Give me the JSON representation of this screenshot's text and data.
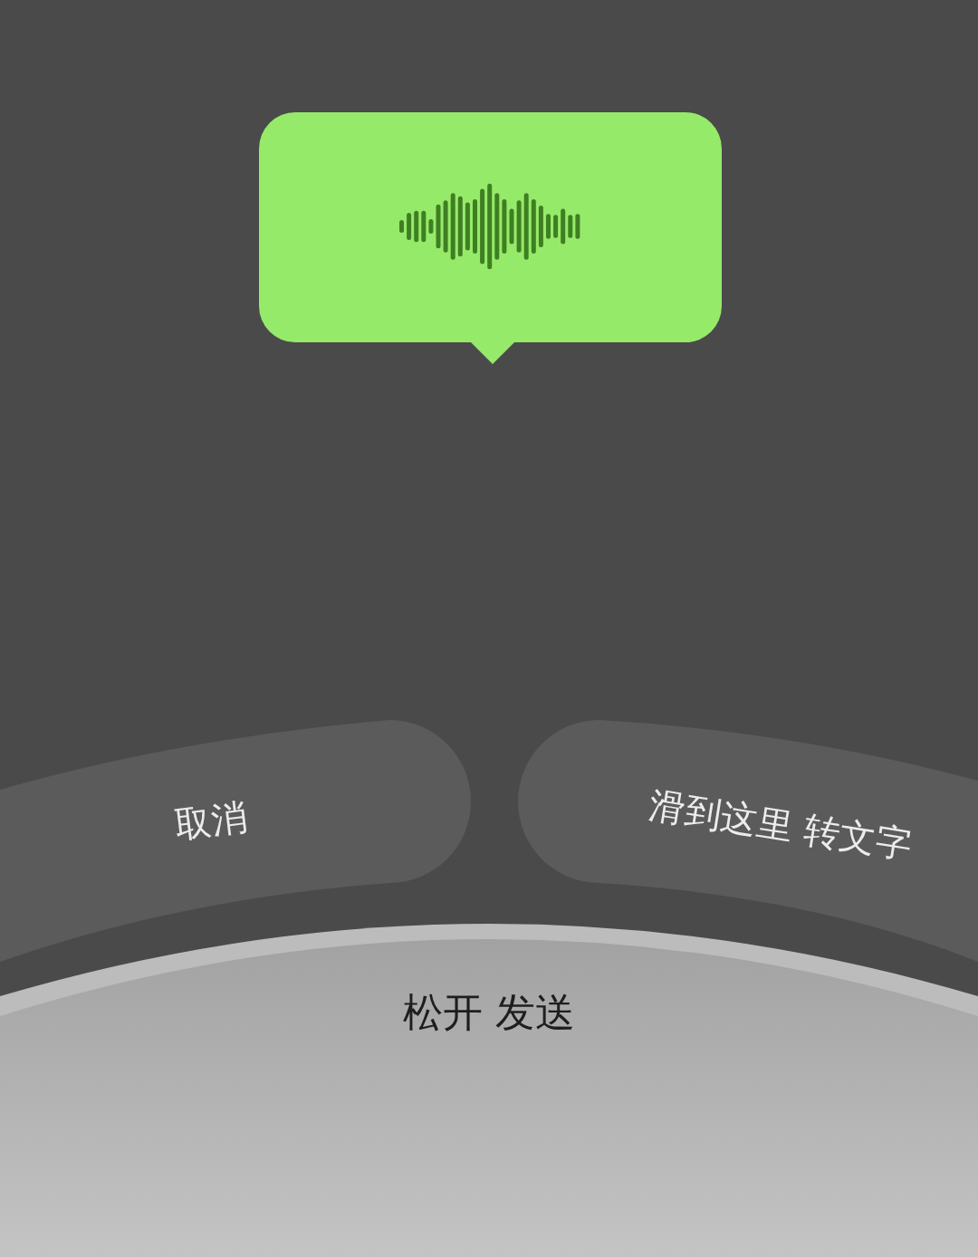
{
  "cancel_zone": {
    "label": "取消"
  },
  "convert_zone": {
    "label": "滑到这里 转文字"
  },
  "send_zone": {
    "label": "松开 发送"
  }
}
